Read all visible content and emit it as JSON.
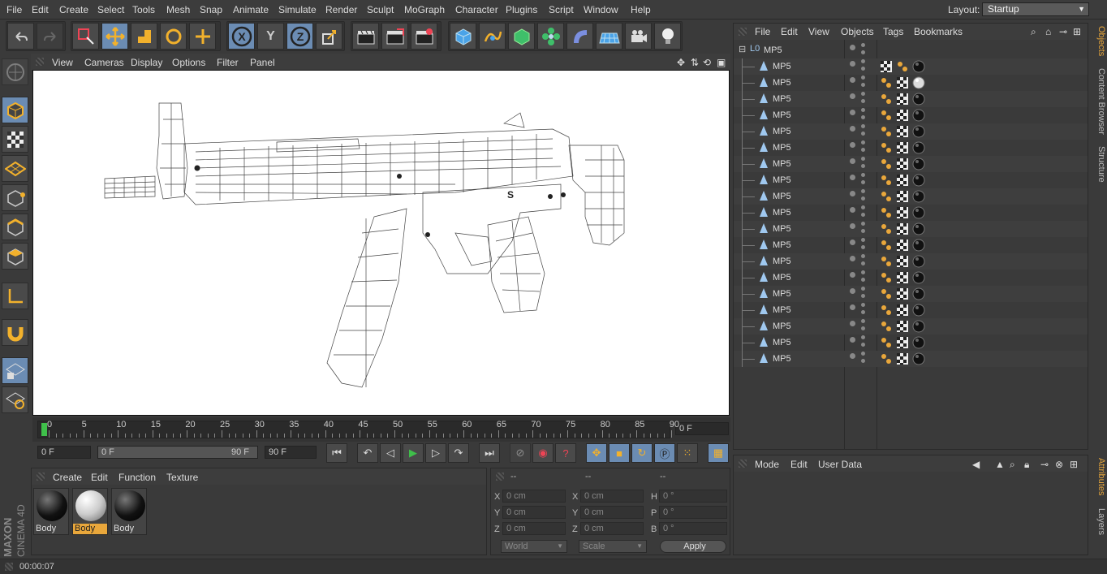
{
  "menu": [
    "File",
    "Edit",
    "Create",
    "Select",
    "Tools",
    "Mesh",
    "Snap",
    "Animate",
    "Simulate",
    "Render",
    "Sculpt",
    "MoGraph",
    "Character",
    "Plugins",
    "Script",
    "Window",
    "Help"
  ],
  "layout": {
    "label": "Layout:",
    "value": "Startup"
  },
  "viewport": {
    "menu": [
      "View",
      "Cameras",
      "Display",
      "Options",
      "Filter",
      "Panel"
    ]
  },
  "timeline": {
    "ticks": [
      "0",
      "5",
      "10",
      "15",
      "20",
      "25",
      "30",
      "35",
      "40",
      "45",
      "50",
      "55",
      "60",
      "65",
      "70",
      "75",
      "80",
      "85",
      "90"
    ],
    "current": "0 F"
  },
  "transport": {
    "start": "0 F",
    "range_start": "0 F",
    "range_end": "90 F",
    "end": "90 F"
  },
  "materials": {
    "menu": [
      "Create",
      "Edit",
      "Function",
      "Texture"
    ],
    "items": [
      {
        "name": "Body",
        "style": "black"
      },
      {
        "name": "Body",
        "style": "white",
        "selected": true
      },
      {
        "name": "Body",
        "style": "black"
      }
    ]
  },
  "coords": {
    "headers": [
      "--",
      "--",
      "--"
    ],
    "rows": [
      {
        "a": "X",
        "av": "0 cm",
        "b": "X",
        "bv": "0 cm",
        "c": "H",
        "cv": "0 °"
      },
      {
        "a": "Y",
        "av": "0 cm",
        "b": "Y",
        "bv": "0 cm",
        "c": "P",
        "cv": "0 °"
      },
      {
        "a": "Z",
        "av": "0 cm",
        "b": "Z",
        "bv": "0 cm",
        "c": "B",
        "cv": "0 °"
      }
    ],
    "mode1": "World",
    "mode2": "Scale",
    "apply": "Apply"
  },
  "objects": {
    "menu": [
      "File",
      "Edit",
      "View",
      "Objects",
      "Tags",
      "Bookmarks"
    ],
    "root": "MP5",
    "children": [
      "MP5",
      "MP5",
      "MP5",
      "MP5",
      "MP5",
      "MP5",
      "MP5",
      "MP5",
      "MP5",
      "MP5",
      "MP5",
      "MP5",
      "MP5",
      "MP5",
      "MP5",
      "MP5",
      "MP5",
      "MP5",
      "MP5"
    ]
  },
  "attributes": {
    "menu": [
      "Mode",
      "Edit",
      "User Data"
    ]
  },
  "rail": {
    "tabs": [
      "Objects",
      "Content Browser",
      "Structure"
    ],
    "tabs2": [
      "Attributes",
      "Layers"
    ]
  },
  "status": {
    "time": "00:00:07"
  },
  "brand": {
    "line1": "MAXON",
    "line2": "CINEMA 4D"
  },
  "viewport_label": "S",
  "colors": {
    "accent": "#e9a73b",
    "selected_tool": "#6b8cb3",
    "panel": "#3a3a3a"
  }
}
